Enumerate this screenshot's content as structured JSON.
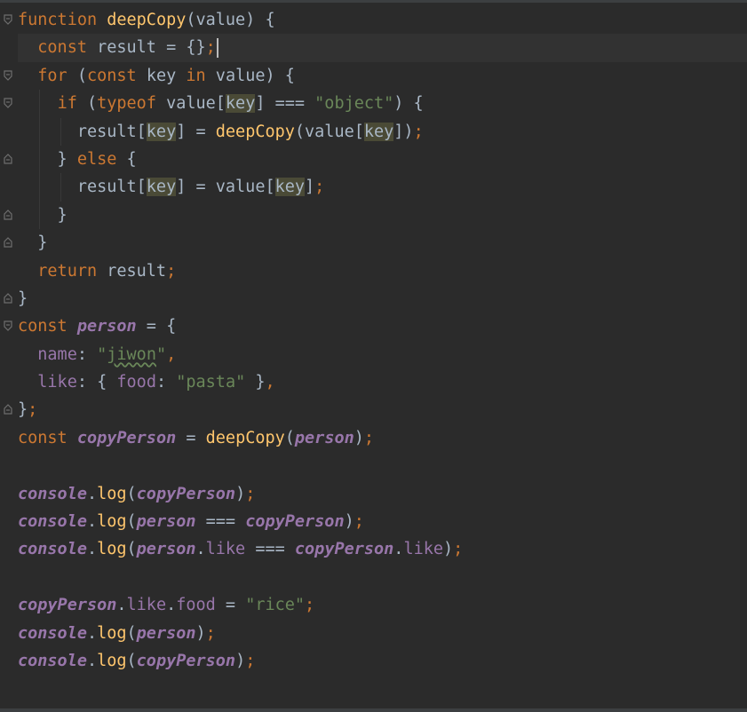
{
  "editor": {
    "lines": [
      "function deepCopy(value) {",
      "  const result = {};",
      "  for (const key in value) {",
      "    if (typeof value[key] === \"object\") {",
      "      result[key] = deepCopy(value[key]);",
      "    } else {",
      "      result[key] = value[key];",
      "    }",
      "  }",
      "  return result;",
      "}",
      "const person = {",
      "  name: \"jiwon\",",
      "  like: { food: \"pasta\" },",
      "};",
      "const copyPerson = deepCopy(person);",
      "",
      "console.log(copyPerson);",
      "console.log(person === copyPerson);",
      "console.log(person.like === copyPerson.like);",
      "",
      "copyPerson.like.food = \"rice\";",
      "console.log(person);",
      "console.log(copyPerson);"
    ],
    "current_line": 2,
    "colors": {
      "background": "#2b2b2b",
      "keyword": "#cc7832",
      "function": "#ffc66d",
      "string": "#6a8759",
      "property": "#9876aa",
      "text": "#a9b7c6"
    }
  }
}
